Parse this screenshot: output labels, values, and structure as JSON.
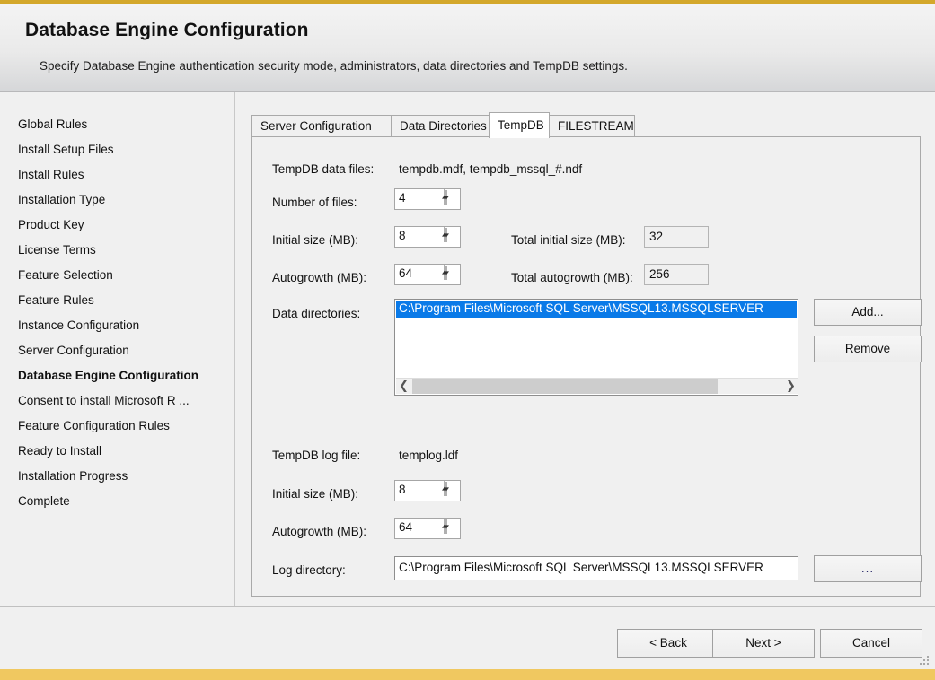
{
  "window": {
    "title": "Database Engine Configuration",
    "subtitle": "Specify Database Engine authentication security mode, administrators, data directories and TempDB settings.",
    "accent_top_color": "#d4a82c",
    "accent_bottom_color": "#f0c860"
  },
  "sidebar": {
    "items": [
      {
        "label": "Global Rules",
        "current": false
      },
      {
        "label": "Install Setup Files",
        "current": false
      },
      {
        "label": "Install Rules",
        "current": false
      },
      {
        "label": "Installation Type",
        "current": false
      },
      {
        "label": "Product Key",
        "current": false
      },
      {
        "label": "License Terms",
        "current": false
      },
      {
        "label": "Feature Selection",
        "current": false
      },
      {
        "label": "Feature Rules",
        "current": false
      },
      {
        "label": "Instance Configuration",
        "current": false
      },
      {
        "label": "Server Configuration",
        "current": false
      },
      {
        "label": "Database Engine Configuration",
        "current": true
      },
      {
        "label": "Consent to install Microsoft R ...",
        "current": false
      },
      {
        "label": "Feature Configuration Rules",
        "current": false
      },
      {
        "label": "Ready to Install",
        "current": false
      },
      {
        "label": "Installation Progress",
        "current": false
      },
      {
        "label": "Complete",
        "current": false
      }
    ]
  },
  "tabs": [
    {
      "label": "Server Configuration",
      "active": false
    },
    {
      "label": "Data Directories",
      "active": false
    },
    {
      "label": "TempDB",
      "active": true
    },
    {
      "label": "FILESTREAM",
      "active": false
    }
  ],
  "tempdb": {
    "data_files_label": "TempDB data files:",
    "data_files_value": "tempdb.mdf, tempdb_mssql_#.ndf",
    "number_of_files_label": "Number of files:",
    "number_of_files_value": "4",
    "initial_size_label": "Initial size (MB):",
    "initial_size_value": "8",
    "total_initial_size_label": "Total initial size (MB):",
    "total_initial_size_value": "32",
    "autogrowth_label": "Autogrowth (MB):",
    "autogrowth_value": "64",
    "total_autogrowth_label": "Total autogrowth (MB):",
    "total_autogrowth_value": "256",
    "data_directories_label": "Data directories:",
    "data_directories_selected": "C:\\Program Files\\Microsoft SQL Server\\MSSQL13.MSSQLSERVER",
    "add_button": "Add...",
    "remove_button": "Remove",
    "log_file_label": "TempDB log file:",
    "log_file_value": "templog.ldf",
    "log_initial_size_label": "Initial size (MB):",
    "log_initial_size_value": "8",
    "log_autogrowth_label": "Autogrowth (MB):",
    "log_autogrowth_value": "64",
    "log_directory_label": "Log directory:",
    "log_directory_value": "C:\\Program Files\\Microsoft SQL Server\\MSSQL13.MSSQLSERVER",
    "log_directory_browse": "...",
    "selection_color": "#0a7ae8"
  },
  "footer": {
    "back_button": "< Back",
    "next_button": "Next >",
    "cancel_button": "Cancel"
  }
}
